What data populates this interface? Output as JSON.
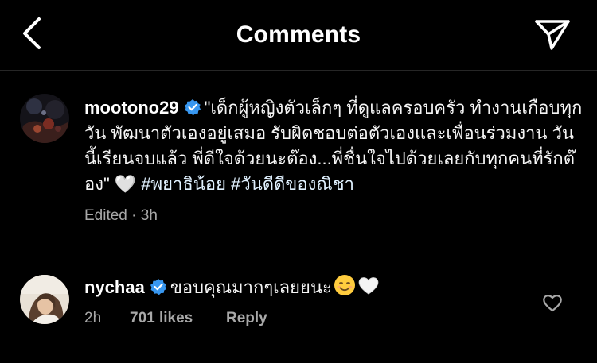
{
  "header": {
    "title": "Comments",
    "back_icon": "chevron-left-icon",
    "send_icon": "paper-plane-icon"
  },
  "caption": {
    "username": "mootono29",
    "verified": true,
    "text": "\"เด็กผู้หญิงตัวเล็กๆ ที่ดูแลครอบครัว ทำงานเกือบทุกวัน พัฒนาตัวเองอยู่เสมอ รับผิดชอบต่อตัวเองและเพื่อนร่วมงาน วันนี้เรียนจบแล้ว พี่ดีใจด้วยนะต๊อง...พี่ชื่นใจไปด้วยเลยกับทุกคนที่รักต๊อง\"",
    "emoji": "🤍",
    "hashtags": [
      "#พยาธิน้อย",
      "#วันดีดีของณิชา"
    ],
    "edited_label": "Edited · 3h"
  },
  "reply": {
    "username": "nychaa",
    "verified": true,
    "text": "ขอบคุณมากๆเลยยนะ",
    "emojis": [
      "smiling-face-emoji",
      "white-heart-emoji"
    ],
    "time": "2h",
    "likes": "701 likes",
    "reply_label": "Reply",
    "like_icon": "heart-outline-icon"
  },
  "colors": {
    "background": "#000000",
    "text": "#f5f5f5",
    "secondary": "#a8a8a8",
    "verified_blue": "#3897f0",
    "divider": "#262626"
  }
}
